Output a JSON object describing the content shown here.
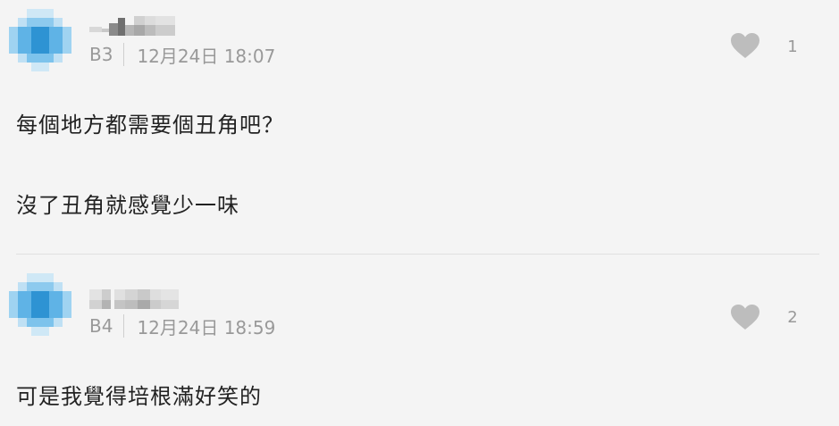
{
  "comments": [
    {
      "floor": "B3",
      "time": "12月24日 18:07",
      "likes": "1",
      "lines": [
        "每個地方都需要個丑角吧？",
        "沒了丑角就感覺少一味"
      ]
    },
    {
      "floor": "B4",
      "time": "12月24日 18:59",
      "likes": "2",
      "lines": [
        "可是我覺得培根滿好笑的"
      ]
    }
  ],
  "colors": {
    "background": "#f4f4f4",
    "heart": "#bdbdbd",
    "meta_text": "#999999"
  },
  "icons": {
    "like": "heart-icon",
    "avatar": "pixelated-avatar"
  }
}
